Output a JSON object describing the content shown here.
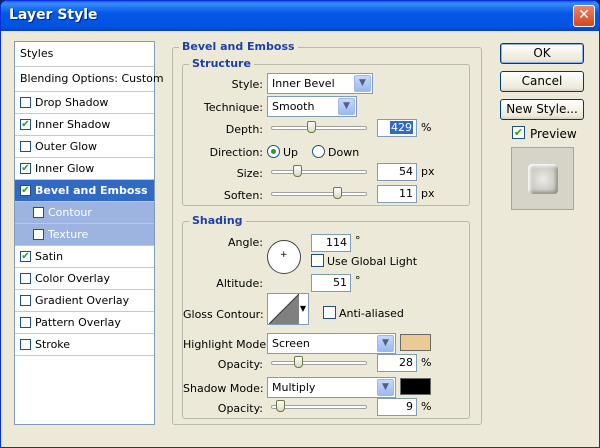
{
  "window": {
    "title": "Layer Style",
    "close_glyph": "✕"
  },
  "styles_list": {
    "header": "Styles",
    "blending": "Blending Options: Custom",
    "items": [
      {
        "label": "Drop Shadow",
        "checked": false
      },
      {
        "label": "Inner Shadow",
        "checked": true
      },
      {
        "label": "Outer Glow",
        "checked": false
      },
      {
        "label": "Inner Glow",
        "checked": true
      },
      {
        "label": "Bevel and Emboss",
        "checked": true,
        "selected": true
      },
      {
        "label": "Contour",
        "checked": false,
        "sub": true
      },
      {
        "label": "Texture",
        "checked": false,
        "sub": true
      },
      {
        "label": "Satin",
        "checked": true
      },
      {
        "label": "Color Overlay",
        "checked": false
      },
      {
        "label": "Gradient Overlay",
        "checked": false
      },
      {
        "label": "Pattern Overlay",
        "checked": false
      },
      {
        "label": "Stroke",
        "checked": false
      }
    ]
  },
  "bevel": {
    "section_title": "Bevel and Emboss",
    "structure": {
      "title": "Structure",
      "style_label": "Style:",
      "style_value": "Inner Bevel",
      "technique_label": "Technique:",
      "technique_value": "Smooth",
      "depth_label": "Depth:",
      "depth_value": "429",
      "depth_unit": "%",
      "depth_slider": 0.42,
      "direction_label": "Direction:",
      "direction_up": "Up",
      "direction_down": "Down",
      "direction_selected": "Up",
      "size_label": "Size:",
      "size_value": "54",
      "size_unit": "px",
      "size_slider": 0.27,
      "soften_label": "Soften:",
      "soften_value": "11",
      "soften_unit": "px",
      "soften_slider": 0.69
    },
    "shading": {
      "title": "Shading",
      "angle_label": "Angle:",
      "angle_value": "114",
      "angle_unit": "°",
      "global_light_label": "Use Global Light",
      "global_light_checked": false,
      "altitude_label": "Altitude:",
      "altitude_value": "51",
      "altitude_unit": "°",
      "gloss_label": "Gloss Contour:",
      "antialiased_label": "Anti-aliased",
      "antialiased_checked": false,
      "highlight_mode_label": "Highlight Mode:",
      "highlight_mode_value": "Screen",
      "highlight_color": "#e8cc94",
      "highlight_opacity_label": "Opacity:",
      "highlight_opacity_value": "28",
      "highlight_opacity_unit": "%",
      "highlight_opacity_slider": 0.28,
      "shadow_mode_label": "Shadow Mode:",
      "shadow_mode_value": "Multiply",
      "shadow_color": "#000000",
      "shadow_opacity_label": "Opacity:",
      "shadow_opacity_value": "9",
      "shadow_opacity_unit": "%",
      "shadow_opacity_slider": 0.09
    }
  },
  "buttons": {
    "ok": "OK",
    "cancel": "Cancel",
    "new_style": "New Style...",
    "preview": "Preview",
    "preview_checked": true
  }
}
